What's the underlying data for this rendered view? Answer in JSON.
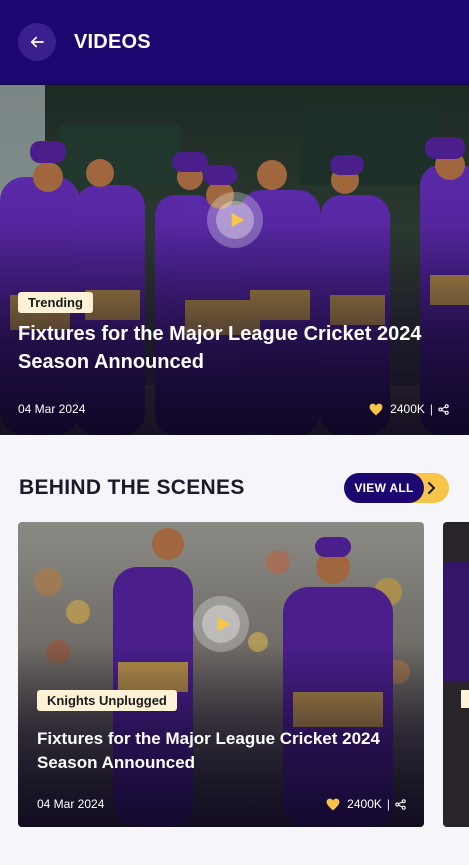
{
  "header": {
    "title": "VIDEOS",
    "back_icon": "arrow-left-icon"
  },
  "hero": {
    "tag": "Trending",
    "title": "Fixtures for the Major League Cricket 2024 Season Announced",
    "date": "04 Mar 2024",
    "likes": "2400K",
    "separator": "|"
  },
  "section": {
    "title": "BEHIND THE SCENES",
    "view_all_label": "VIEW ALL"
  },
  "cards": [
    {
      "tag": "Knights Unplugged",
      "title": "Fixtures for the Major League Cricket 2024 Season Announced",
      "date": "04 Mar 2024",
      "likes": "2400K",
      "separator": "|"
    }
  ],
  "colors": {
    "primary": "#1c0770",
    "accent": "#f6c54a",
    "tag_bg": "#fdf1d6"
  }
}
